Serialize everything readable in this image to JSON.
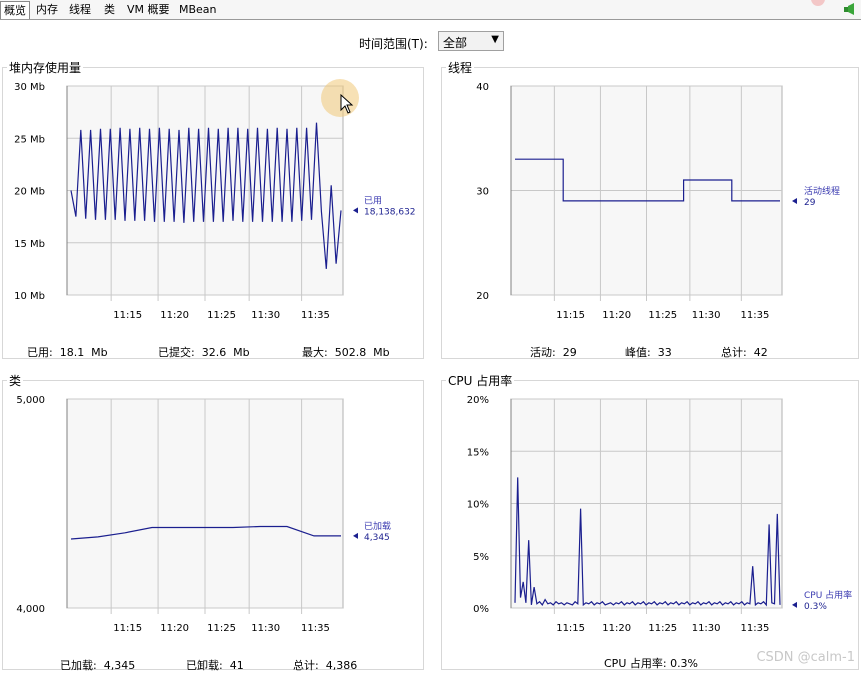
{
  "tabs": [
    "概览",
    "内存",
    "线程",
    "类",
    "VM 概要",
    "MBean"
  ],
  "time_range": {
    "label": "时间范围(T):",
    "value": "全部"
  },
  "panels": {
    "heap": {
      "title": "堆内存使用量",
      "legend": "已用",
      "legend_value": "18,138,632",
      "stats": [
        "已用:  18.1  Mb",
        "已提交:  32.6  Mb",
        "最大:  502.8  Mb"
      ]
    },
    "threads": {
      "title": "线程",
      "legend": "活动线程",
      "legend_value": "29",
      "stats": [
        "活动:  29",
        "峰值:  33",
        "总计:  42"
      ]
    },
    "classes": {
      "title": "类",
      "legend": "已加载",
      "legend_value": "4,345",
      "stats": [
        "已加载:  4,345",
        "已卸载:  41",
        "总计:  4,386"
      ]
    },
    "cpu": {
      "title": "CPU 占用率",
      "legend": "CPU 占用率",
      "legend_value": "0.3%",
      "stats": [
        "CPU 占用率: 0.3%"
      ]
    }
  },
  "watermark": "CSDN @calm-1",
  "colors": {
    "series": "#1b1f8f",
    "grid": "#c8c8c8",
    "legend_text": "#3a3ab0"
  },
  "chart_data": [
    {
      "type": "line",
      "title": "堆内存使用量",
      "x_ticks": [
        "11:15",
        "11:20",
        "11:25",
        "11:30",
        "11:35"
      ],
      "y_ticks": [
        "30 Mb",
        "25 Mb",
        "20 Mb",
        "15 Mb",
        "10 Mb"
      ],
      "ylim": [
        10,
        30
      ],
      "series": [
        {
          "name": "已用",
          "values": [
            20,
            17.5,
            25.8,
            17.3,
            25.8,
            17.2,
            25.9,
            17.2,
            25.9,
            17.2,
            26,
            17.1,
            25.9,
            17.1,
            26,
            17.1,
            25.9,
            17,
            26,
            17,
            25.9,
            17,
            25.8,
            16.9,
            26,
            17,
            25.9,
            17,
            26,
            17,
            25.9,
            17,
            26,
            17.1,
            26,
            17,
            25.9,
            17,
            26,
            17,
            25.9,
            17,
            26,
            17,
            25.9,
            17,
            26,
            17.1,
            26,
            17.2,
            26.5,
            18,
            12.5,
            20.5,
            13,
            18.1
          ]
        }
      ]
    },
    {
      "type": "line",
      "title": "线程",
      "x_ticks": [
        "11:15",
        "11:20",
        "11:25",
        "11:30",
        "11:35"
      ],
      "y_ticks": [
        "40",
        "30",
        "20"
      ],
      "ylim": [
        20,
        40
      ],
      "series": [
        {
          "name": "活动线程",
          "values": [
            33,
            33,
            29,
            29,
            29,
            29,
            29,
            31,
            31,
            29,
            29,
            29
          ]
        }
      ]
    },
    {
      "type": "line",
      "title": "类",
      "x_ticks": [
        "11:15",
        "11:20",
        "11:25",
        "11:30",
        "11:35"
      ],
      "y_ticks": [
        "5,000",
        "4,000"
      ],
      "ylim": [
        4000,
        5000
      ],
      "series": [
        {
          "name": "已加载",
          "values": [
            4330,
            4340,
            4360,
            4385,
            4385,
            4385,
            4385,
            4390,
            4390,
            4345,
            4345
          ]
        }
      ]
    },
    {
      "type": "line",
      "title": "CPU 占用率",
      "x_ticks": [
        "11:15",
        "11:20",
        "11:25",
        "11:30",
        "11:35"
      ],
      "y_ticks": [
        "20%",
        "15%",
        "10%",
        "5%",
        "0%"
      ],
      "ylim": [
        0,
        20
      ],
      "series": [
        {
          "name": "CPU 占用率",
          "values": [
            0.5,
            12.5,
            1,
            2.5,
            0.5,
            6.5,
            0.3,
            2,
            0.4,
            0.6,
            0.3,
            0.8,
            0.4,
            0.5,
            0.3,
            0.6,
            0.4,
            0.5,
            0.3,
            0.5,
            0.4,
            0.3,
            0.6,
            0.4,
            9.5,
            0.3,
            0.5,
            0.4,
            0.6,
            0.3,
            0.5,
            0.4,
            0.6,
            0.3,
            0.4,
            0.5,
            0.3,
            0.5,
            0.4,
            0.6,
            0.3,
            0.5,
            0.4,
            0.6,
            0.3,
            0.5,
            0.4,
            0.6,
            0.3,
            0.5,
            0.4,
            0.6,
            0.3,
            0.5,
            0.4,
            0.6,
            0.3,
            0.5,
            0.4,
            0.6,
            0.3,
            0.5,
            0.4,
            0.6,
            0.3,
            0.5,
            0.4,
            0.6,
            0.3,
            0.5,
            0.4,
            0.6,
            0.3,
            0.5,
            0.4,
            0.6,
            0.3,
            0.5,
            0.4,
            0.6,
            0.3,
            0.5,
            0.4,
            0.6,
            0.3,
            0.5,
            0.4,
            4,
            0.3,
            0.5,
            0.4,
            0.6,
            0.3,
            8,
            0.5,
            0.4,
            9,
            0.3
          ]
        }
      ]
    }
  ]
}
